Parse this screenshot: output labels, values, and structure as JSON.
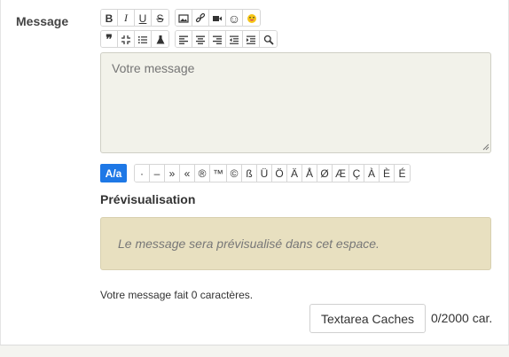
{
  "field": {
    "label": "Message"
  },
  "toolbar_row1": [
    {
      "group": [
        {
          "icon": "bold-icon",
          "glyph": "B"
        },
        {
          "icon": "italic-icon",
          "glyph": "I"
        },
        {
          "icon": "underline-icon",
          "glyph": "U"
        },
        {
          "icon": "strikethrough-icon",
          "glyph": "S"
        }
      ]
    },
    {
      "group": [
        {
          "icon": "image-icon",
          "glyph": ""
        },
        {
          "icon": "link-icon",
          "glyph": ""
        },
        {
          "icon": "video-icon",
          "glyph": ""
        },
        {
          "icon": "smiley-icon",
          "glyph": "☺"
        },
        {
          "icon": "emoji-icon",
          "glyph": ""
        }
      ]
    }
  ],
  "toolbar_row2": [
    {
      "group": [
        {
          "icon": "quote-icon",
          "glyph": "❞"
        },
        {
          "icon": "compress-icon",
          "glyph": ""
        },
        {
          "icon": "list-icon",
          "glyph": ""
        },
        {
          "icon": "flask-icon",
          "glyph": ""
        }
      ]
    },
    {
      "group": [
        {
          "icon": "align-left-icon",
          "glyph": ""
        },
        {
          "icon": "align-center-icon",
          "glyph": ""
        },
        {
          "icon": "align-right-icon",
          "glyph": ""
        },
        {
          "icon": "outdent-icon",
          "glyph": ""
        },
        {
          "icon": "indent-icon",
          "glyph": ""
        },
        {
          "icon": "zoom-icon",
          "glyph": ""
        }
      ]
    }
  ],
  "textarea": {
    "placeholder": "Votre message"
  },
  "special_chars": {
    "toggle_label": "A/a",
    "chars": [
      "·",
      "–",
      "»",
      "«",
      "®",
      "™",
      "©",
      "ß",
      "Ü",
      "Ö",
      "Ä",
      "Å",
      "Ø",
      "Æ",
      "Ç",
      "À",
      "È",
      "É"
    ]
  },
  "preview": {
    "title": "Prévisualisation",
    "placeholder": "Le message sera prévisualisé dans cet espace."
  },
  "footer": {
    "length_text": "Votre message fait 0 caractères.",
    "caches_button": "Textarea Caches",
    "counter": "0/2000 car."
  },
  "colors": {
    "accent": "#1e78e6",
    "textarea_bg": "#f2f2ea",
    "preview_bg": "#e8e0c0"
  }
}
